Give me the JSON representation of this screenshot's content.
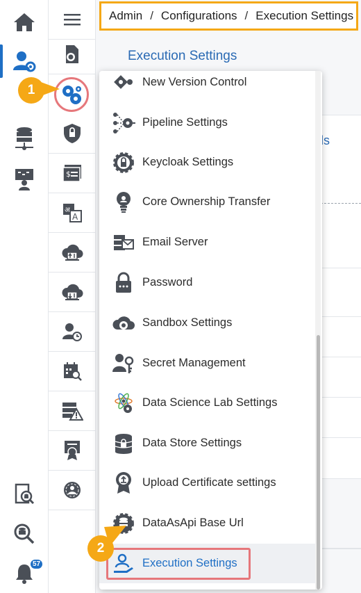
{
  "breadcrumb": {
    "items": [
      "Admin",
      "Configurations",
      "Execution Settings"
    ],
    "separator": "/"
  },
  "page": {
    "title": "Execution Settings",
    "partial_link": "ls"
  },
  "rail": {
    "items": [
      "home-icon",
      "admin-user-settings-icon",
      "data-center-icon",
      "presentation-user-icon",
      "data-search-icon",
      "search-data-icon",
      "notification-bell-icon"
    ],
    "notification_count": "57"
  },
  "submenu": {
    "items": [
      "document-gear-icon",
      "configurations-gears-icon",
      "security-shield-icon",
      "license-card-icon",
      "language-translate-icon",
      "cloud-upload-icon",
      "cloud-download-icon",
      "user-schedule-icon",
      "calendar-search-icon",
      "server-warning-icon",
      "certificate-icon",
      "user-settings-icon"
    ]
  },
  "dropdown": {
    "items": [
      {
        "label": "New Version Control",
        "icon": "version-control-icon"
      },
      {
        "label": "Pipeline Settings",
        "icon": "pipeline-icon"
      },
      {
        "label": "Keycloak Settings",
        "icon": "keycloak-icon"
      },
      {
        "label": "Core Ownership Transfer",
        "icon": "bulb-icon"
      },
      {
        "label": "Email Server",
        "icon": "email-server-icon"
      },
      {
        "label": "Password",
        "icon": "password-lock-icon"
      },
      {
        "label": "Sandbox Settings",
        "icon": "sandbox-cloud-icon"
      },
      {
        "label": "Secret Management",
        "icon": "secret-key-icon"
      },
      {
        "label": "Data Science Lab Settings",
        "icon": "science-lab-icon"
      },
      {
        "label": "Data Store Settings",
        "icon": "data-store-icon"
      },
      {
        "label": "Upload Certificate settings",
        "icon": "certificate-upload-icon"
      },
      {
        "label": "DataAsApi Base Url",
        "icon": "api-gear-icon"
      },
      {
        "label": "Execution Settings",
        "icon": "execution-hand-icon",
        "selected": true
      }
    ]
  },
  "callouts": [
    "1",
    "2"
  ],
  "colors": {
    "accent": "#1f6fc5",
    "highlight": "#f5a816",
    "selection_border": "#e6777b"
  }
}
